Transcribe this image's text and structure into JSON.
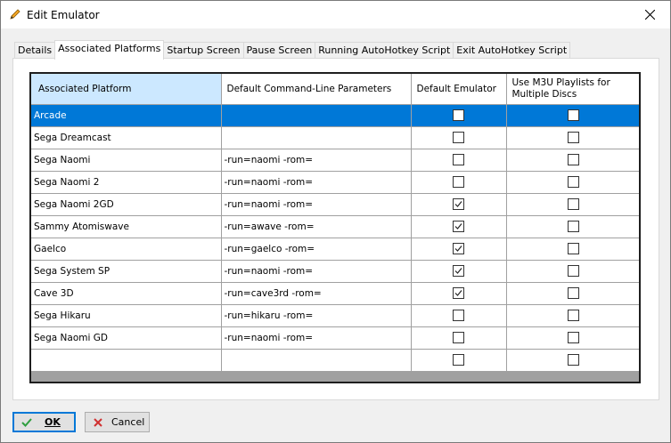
{
  "window": {
    "title": "Edit Emulator"
  },
  "tabs": [
    {
      "label": "Details"
    },
    {
      "label": "Associated Platforms"
    },
    {
      "label": "Startup Screen"
    },
    {
      "label": "Pause Screen"
    },
    {
      "label": "Running AutoHotkey Script"
    },
    {
      "label": "Exit AutoHotkey Script"
    }
  ],
  "grid": {
    "headers": {
      "platform": "Associated Platform",
      "params": "Default Command-Line Parameters",
      "default": "Default Emulator",
      "m3u": "Use M3U Playlists for Multiple Discs"
    },
    "rows": [
      {
        "platform": "Arcade",
        "params": "",
        "default": false,
        "m3u": false,
        "selected": true
      },
      {
        "platform": "Sega Dreamcast",
        "params": "",
        "default": false,
        "m3u": false
      },
      {
        "platform": "Sega Naomi",
        "params": "-run=naomi -rom=",
        "default": false,
        "m3u": false
      },
      {
        "platform": "Sega Naomi 2",
        "params": "-run=naomi -rom=",
        "default": false,
        "m3u": false
      },
      {
        "platform": "Sega Naomi 2GD",
        "params": "-run=naomi -rom=",
        "default": true,
        "m3u": false
      },
      {
        "platform": "Sammy Atomiswave",
        "params": "-run=awave -rom=",
        "default": true,
        "m3u": false
      },
      {
        "platform": "Gaelco",
        "params": "-run=gaelco -rom=",
        "default": true,
        "m3u": false
      },
      {
        "platform": "Sega System SP",
        "params": "-run=naomi -rom=",
        "default": true,
        "m3u": false
      },
      {
        "platform": "Cave 3D",
        "params": "-run=cave3rd -rom=",
        "default": true,
        "m3u": false
      },
      {
        "platform": "Sega Hikaru",
        "params": "-run=hikaru -rom=",
        "default": false,
        "m3u": false
      },
      {
        "platform": "Sega Naomi GD",
        "params": "-run=naomi -rom=",
        "default": false,
        "m3u": false
      },
      {
        "platform": "",
        "params": "",
        "default": false,
        "m3u": false
      }
    ]
  },
  "buttons": {
    "ok_label": "OK",
    "cancel_label": "Cancel"
  },
  "colors": {
    "selection": "#0078d7",
    "header_highlight": "#cce8ff",
    "ok_check": "#2e9e3e",
    "cancel_x": "#d03030"
  }
}
